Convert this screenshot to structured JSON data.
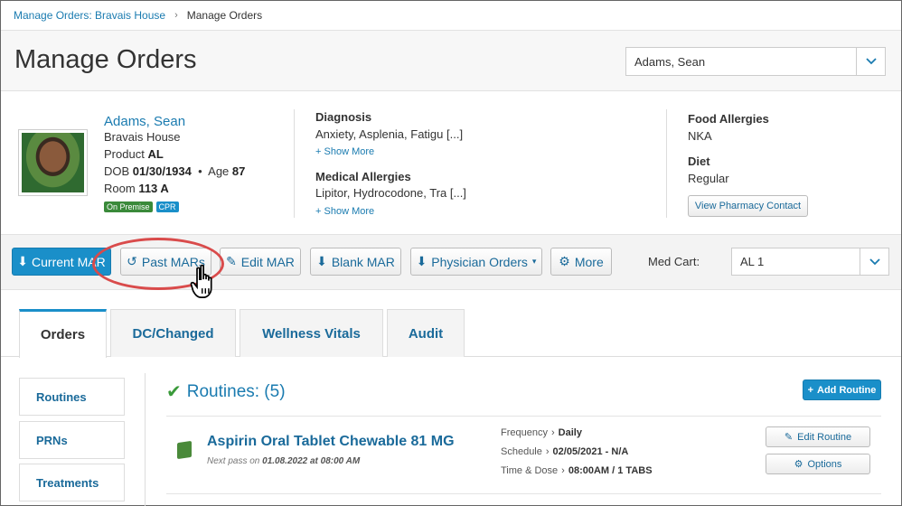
{
  "breadcrumb": {
    "parent": "Manage Orders: Bravais House",
    "current": "Manage Orders"
  },
  "page_title": "Manage Orders",
  "resident_select": {
    "value": "Adams, Sean"
  },
  "resident": {
    "name": "Adams, Sean",
    "facility": "Bravais House",
    "product_label": "Product",
    "product": "AL",
    "dob_label": "DOB",
    "dob": "01/30/1934",
    "age_label": "Age",
    "age": "87",
    "room_label": "Room",
    "room": "113 A",
    "tags": [
      "On Premise",
      "CPR"
    ]
  },
  "diagnosis": {
    "title": "Diagnosis",
    "value": "Anxiety, Asplenia, Fatigu [...]",
    "show_more": "Show More"
  },
  "medical_allergies": {
    "title": "Medical Allergies",
    "value": "Lipitor, Hydrocodone, Tra [...]",
    "show_more": "Show More"
  },
  "food_allergies": {
    "title": "Food Allergies",
    "value": "NKA"
  },
  "diet": {
    "title": "Diet",
    "value": "Regular"
  },
  "pharmacy_button": "View Pharmacy Contact",
  "actions": {
    "current_mar": "Current MAR",
    "past_mars": "Past MARs",
    "edit_mar": "Edit MAR",
    "blank_mar": "Blank MAR",
    "physician_orders": "Physician Orders",
    "more": "More",
    "med_cart_label": "Med Cart:",
    "med_cart_value": "AL 1"
  },
  "tabs": [
    "Orders",
    "DC/Changed",
    "Wellness Vitals",
    "Audit"
  ],
  "side_nav": [
    "Routines",
    "PRNs",
    "Treatments"
  ],
  "routines": {
    "title": "Routines: (5)",
    "add_button": "Add Routine",
    "item": {
      "name": "Aspirin Oral Tablet Chewable 81 MG",
      "next_pass_prefix": "Next pass on",
      "next_pass_date": "01.08.2022 at 08:00 AM",
      "frequency_label": "Frequency",
      "frequency": "Daily",
      "schedule_label": "Schedule",
      "schedule": "02/05/2021 - N/A",
      "time_dose_label": "Time & Dose",
      "time_dose": "08:00AM / 1 TABS",
      "edit_button": "Edit Routine",
      "options_button": "Options"
    }
  },
  "colors": {
    "primary": "#1a8fc9",
    "link": "#1a7bb0",
    "highlight": "#d94b4b",
    "success": "#3a9a3a"
  }
}
